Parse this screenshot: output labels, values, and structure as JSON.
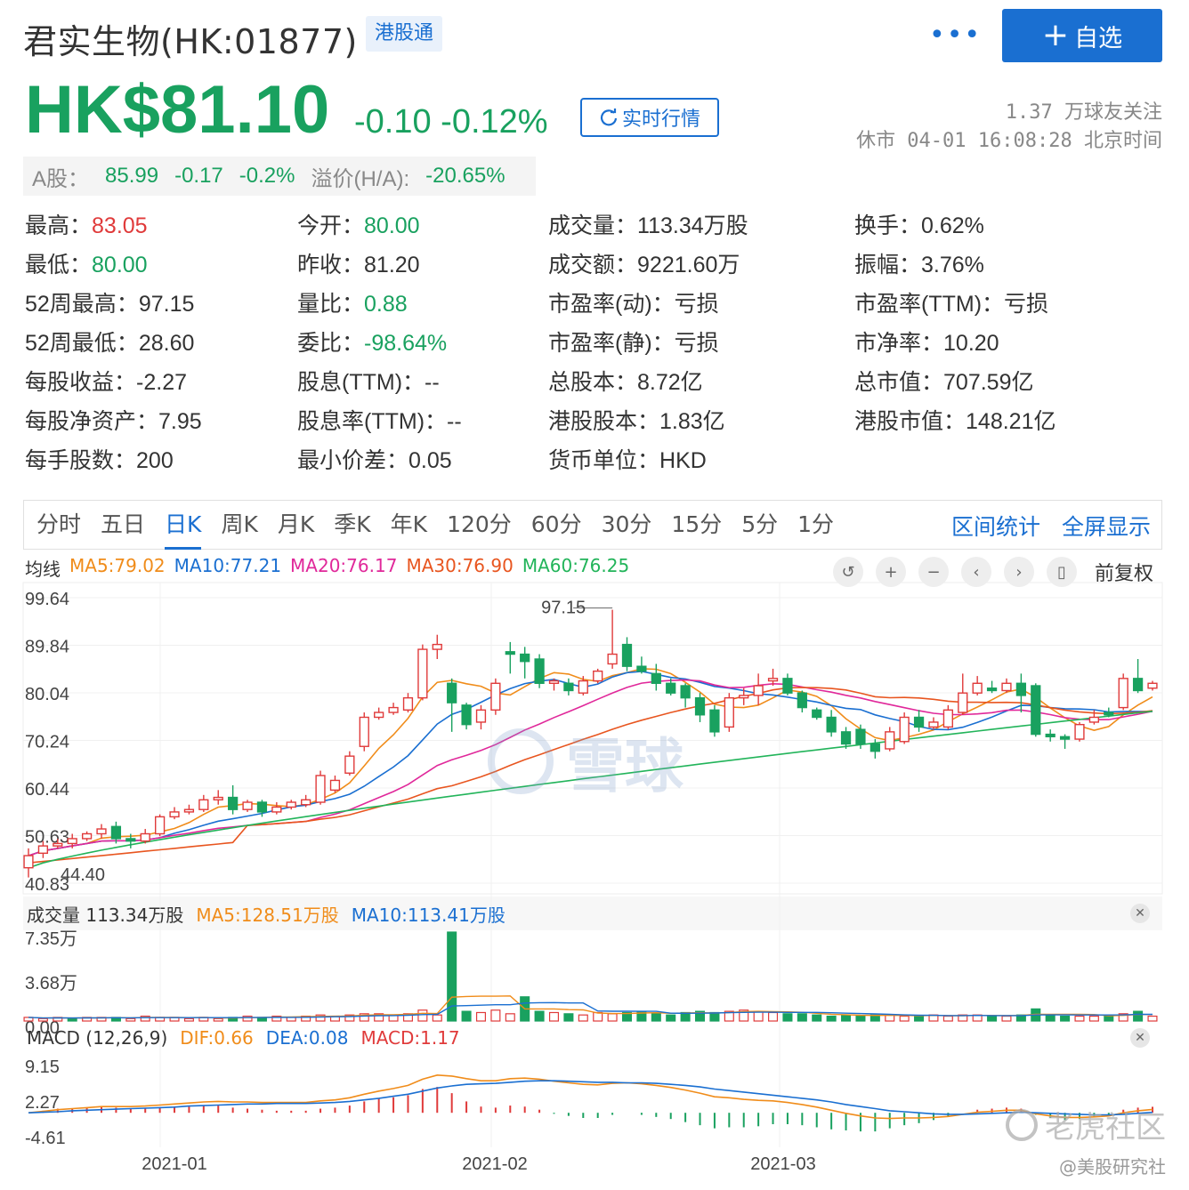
{
  "header": {
    "stock_name": "君实生物(HK:01877)",
    "connect_tag": "港股通",
    "more": "•••",
    "add_button": "自选",
    "price": "HK$81.10",
    "change": "-0.10 -0.12%",
    "realtime_button": "实时行情",
    "followers": "1.37 万球友关注",
    "status": "休市 04-01 16:08:28 北京时间"
  },
  "a_share": {
    "label": "A股：",
    "price": "85.99",
    "change": "-0.17",
    "pct": "-0.2%",
    "premium_label": "溢价(H/A):",
    "premium": "-20.65%"
  },
  "stats": [
    {
      "label": "最高：",
      "value": "83.05",
      "tone": "red"
    },
    {
      "label": "今开：",
      "value": "80.00",
      "tone": "green"
    },
    {
      "label": "成交量：",
      "value": "113.34万股",
      "tone": ""
    },
    {
      "label": "换手：",
      "value": "0.62%",
      "tone": ""
    },
    {
      "label": "最低：",
      "value": "80.00",
      "tone": "green"
    },
    {
      "label": "昨收：",
      "value": "81.20",
      "tone": ""
    },
    {
      "label": "成交额：",
      "value": "9221.60万",
      "tone": ""
    },
    {
      "label": "振幅：",
      "value": "3.76%",
      "tone": ""
    },
    {
      "label": "52周最高：",
      "value": "97.15",
      "tone": ""
    },
    {
      "label": "量比：",
      "value": "0.88",
      "tone": "green"
    },
    {
      "label": "市盈率(动)：",
      "value": "亏损",
      "tone": ""
    },
    {
      "label": "市盈率(TTM)：",
      "value": "亏损",
      "tone": ""
    },
    {
      "label": "52周最低：",
      "value": "28.60",
      "tone": ""
    },
    {
      "label": "委比：",
      "value": "-98.64%",
      "tone": "green"
    },
    {
      "label": "市盈率(静)：",
      "value": "亏损",
      "tone": ""
    },
    {
      "label": "市净率：",
      "value": "10.20",
      "tone": ""
    },
    {
      "label": "每股收益：",
      "value": "-2.27",
      "tone": ""
    },
    {
      "label": "股息(TTM)：",
      "value": "--",
      "tone": ""
    },
    {
      "label": "总股本：",
      "value": "8.72亿",
      "tone": ""
    },
    {
      "label": "总市值：",
      "value": "707.59亿",
      "tone": ""
    },
    {
      "label": "每股净资产：",
      "value": "7.95",
      "tone": ""
    },
    {
      "label": "股息率(TTM)：",
      "value": "--",
      "tone": ""
    },
    {
      "label": "港股股本：",
      "value": "1.83亿",
      "tone": ""
    },
    {
      "label": "港股市值：",
      "value": "148.21亿",
      "tone": ""
    },
    {
      "label": "每手股数：",
      "value": "200",
      "tone": ""
    },
    {
      "label": "最小价差：",
      "value": "0.05",
      "tone": ""
    },
    {
      "label": "货币单位：",
      "value": "HKD",
      "tone": ""
    }
  ],
  "tabs": [
    "分时",
    "五日",
    "日K",
    "周K",
    "月K",
    "季K",
    "年K",
    "120分",
    "60分",
    "30分",
    "15分",
    "5分",
    "1分"
  ],
  "active_tab": "日K",
  "tab_actions": [
    "区间统计",
    "全屏显示"
  ],
  "ma_legend": {
    "title": "均线",
    "items": [
      {
        "label": "MA5:79.02",
        "color": "#f08c1a"
      },
      {
        "label": "MA10:77.21",
        "color": "#1a6fd1"
      },
      {
        "label": "MA20:76.17",
        "color": "#e0289a"
      },
      {
        "label": "MA30:76.90",
        "color": "#e8551f"
      },
      {
        "label": "MA60:76.25",
        "color": "#22b45a"
      }
    ]
  },
  "adjust_label": "前复权",
  "volume_legend": {
    "title": "成交量 113.34万股",
    "ma5": "MA5:128.51万股",
    "ma10": "MA10:113.41万股"
  },
  "macd_legend": {
    "title": "MACD (12,26,9)",
    "dif": "DIF:0.66",
    "dea": "DEA:0.08",
    "macd": "MACD:1.17"
  },
  "watermark": "雪球",
  "corner_watermark": "老虎社区",
  "corner_sub": "@美股研究社",
  "colors": {
    "up": "#e03a3a",
    "down": "#19a15f",
    "accent": "#1a6fd1"
  },
  "chart_data": {
    "type": "candlestick",
    "price_axis": {
      "ticks": [
        "99.64",
        "89.84",
        "80.04",
        "70.24",
        "60.44",
        "50.63",
        "40.83"
      ],
      "ylim": [
        40.83,
        99.64
      ]
    },
    "x_labels": [
      "2021-01",
      "2021-02",
      "2021-03"
    ],
    "annotations": [
      {
        "label": "97.15",
        "type": "high"
      },
      {
        "label": "44.40",
        "type": "low"
      }
    ],
    "candles": [
      [
        44.0,
        46.5,
        42.0,
        48.0
      ],
      [
        47.0,
        48.5,
        46.0,
        49.5
      ],
      [
        48.5,
        49.0,
        48.0,
        50.0
      ],
      [
        49.0,
        50.0,
        48.0,
        51.0
      ],
      [
        50.0,
        51.0,
        49.5,
        51.5
      ],
      [
        51.0,
        52.0,
        50.0,
        53.0
      ],
      [
        52.5,
        50.0,
        49.0,
        53.5
      ],
      [
        50.0,
        49.5,
        48.0,
        51.0
      ],
      [
        49.5,
        51.0,
        49.0,
        52.0
      ],
      [
        51.0,
        54.5,
        50.5,
        55.0
      ],
      [
        54.5,
        55.5,
        54.0,
        56.5
      ],
      [
        55.5,
        56.0,
        55.0,
        57.0
      ],
      [
        56.0,
        58.0,
        55.5,
        59.0
      ],
      [
        58.0,
        58.5,
        57.0,
        60.0
      ],
      [
        58.5,
        56.0,
        55.0,
        61.0
      ],
      [
        56.0,
        57.5,
        55.5,
        58.0
      ],
      [
        57.5,
        55.5,
        54.5,
        58.0
      ],
      [
        55.5,
        56.5,
        55.0,
        57.5
      ],
      [
        56.5,
        57.5,
        56.0,
        58.0
      ],
      [
        57.0,
        58.0,
        56.5,
        59.0
      ],
      [
        57.5,
        63.0,
        57.0,
        64.0
      ],
      [
        60.0,
        62.0,
        59.5,
        63.0
      ],
      [
        63.5,
        67.0,
        63.0,
        68.0
      ],
      [
        69.0,
        75.0,
        68.0,
        76.0
      ],
      [
        75.0,
        76.0,
        74.5,
        77.0
      ],
      [
        76.0,
        77.0,
        75.5,
        78.0
      ],
      [
        76.5,
        79.0,
        76.0,
        80.0
      ],
      [
        79.0,
        89.0,
        78.5,
        90.0
      ],
      [
        89.0,
        90.0,
        87.0,
        92.0
      ],
      [
        82.0,
        78.0,
        72.0,
        83.0
      ],
      [
        77.5,
        73.5,
        72.5,
        78.0
      ],
      [
        74.0,
        76.5,
        72.5,
        77.5
      ],
      [
        76.5,
        82.0,
        75.5,
        83.0
      ],
      [
        88.5,
        88.0,
        84.0,
        90.5
      ],
      [
        88.0,
        86.5,
        83.0,
        89.5
      ],
      [
        87.0,
        82.0,
        81.0,
        88.0
      ],
      [
        82.0,
        82.5,
        80.5,
        83.0
      ],
      [
        82.0,
        80.5,
        79.5,
        83.0
      ],
      [
        80.0,
        82.5,
        79.5,
        83.5
      ],
      [
        82.5,
        84.5,
        82.0,
        85.0
      ],
      [
        86.0,
        88.0,
        85.0,
        97.15
      ],
      [
        90.0,
        85.5,
        84.5,
        91.5
      ],
      [
        85.5,
        84.5,
        84.0,
        87.5
      ],
      [
        84.0,
        82.0,
        80.5,
        86.0
      ],
      [
        82.0,
        80.0,
        79.5,
        83.0
      ],
      [
        81.5,
        79.0,
        77.0,
        82.0
      ],
      [
        79.0,
        75.5,
        74.0,
        80.0
      ],
      [
        76.5,
        72.0,
        71.0,
        77.5
      ],
      [
        73.0,
        79.0,
        72.0,
        80.0
      ],
      [
        79.0,
        79.5,
        77.5,
        81.0
      ],
      [
        79.5,
        81.5,
        77.5,
        84.0
      ],
      [
        82.5,
        83.0,
        81.5,
        85.0
      ],
      [
        83.0,
        80.0,
        79.5,
        84.0
      ],
      [
        80.0,
        77.0,
        76.0,
        80.5
      ],
      [
        76.5,
        75.0,
        74.5,
        77.0
      ],
      [
        75.0,
        72.0,
        71.0,
        76.5
      ],
      [
        72.0,
        69.5,
        68.5,
        73.0
      ],
      [
        72.5,
        69.5,
        68.5,
        73.5
      ],
      [
        69.5,
        68.0,
        66.5,
        70.5
      ],
      [
        68.5,
        72.0,
        68.0,
        73.0
      ],
      [
        70.0,
        75.0,
        69.5,
        76.0
      ],
      [
        75.0,
        73.0,
        72.0,
        76.5
      ],
      [
        73.0,
        74.0,
        72.5,
        75.0
      ],
      [
        73.0,
        76.5,
        72.5,
        77.5
      ],
      [
        76.0,
        80.0,
        75.5,
        84.0
      ],
      [
        80.0,
        82.0,
        79.5,
        83.5
      ],
      [
        81.0,
        80.5,
        80.0,
        82.5
      ],
      [
        80.5,
        82.0,
        80.0,
        83.0
      ],
      [
        82.0,
        79.5,
        76.0,
        84.0
      ],
      [
        81.5,
        71.5,
        71.0,
        82.0
      ],
      [
        71.5,
        71.0,
        70.0,
        72.5
      ],
      [
        71.0,
        70.5,
        68.5,
        71.5
      ],
      [
        70.5,
        73.5,
        70.0,
        74.0
      ],
      [
        74.0,
        75.0,
        73.5,
        76.5
      ],
      [
        76.0,
        75.5,
        75.0,
        77.0
      ],
      [
        77.0,
        83.0,
        76.5,
        84.0
      ],
      [
        83.0,
        80.5,
        80.0,
        87.0
      ],
      [
        81.0,
        82.0,
        80.5,
        82.5
      ]
    ],
    "volume_axis": {
      "ticks": [
        "7.35万",
        "3.68万",
        "0.00"
      ]
    },
    "volume": {
      "values": [
        0.3,
        0.2,
        0.3,
        0.2,
        0.3,
        0.3,
        0.3,
        0.2,
        0.4,
        0.3,
        0.3,
        0.2,
        0.3,
        0.2,
        0.3,
        0.4,
        0.3,
        0.4,
        0.3,
        0.4,
        0.5,
        0.4,
        0.5,
        0.6,
        0.6,
        0.5,
        0.6,
        0.9,
        0.5,
        7.35,
        0.8,
        0.7,
        0.9,
        0.6,
        2.0,
        0.8,
        0.7,
        0.6,
        0.5,
        0.7,
        0.6,
        0.7,
        0.8,
        0.6,
        0.5,
        0.7,
        0.8,
        0.7,
        0.8,
        0.9,
        0.8,
        0.7,
        0.6,
        0.6,
        0.5,
        0.4,
        0.5,
        0.4,
        0.5,
        0.5,
        0.4,
        0.4,
        0.5,
        0.4,
        0.5,
        0.5,
        0.4,
        0.4,
        0.5,
        1.0,
        0.5,
        0.4,
        0.4,
        0.4,
        0.5,
        0.6,
        0.8,
        0.4
      ],
      "up": [
        1,
        1,
        1,
        0,
        1,
        1,
        0,
        1,
        1,
        1,
        1,
        1,
        1,
        1,
        0,
        1,
        0,
        1,
        1,
        1,
        1,
        1,
        1,
        1,
        1,
        1,
        1,
        1,
        1,
        0,
        0,
        1,
        1,
        1,
        0,
        0,
        1,
        0,
        1,
        1,
        1,
        0,
        0,
        0,
        0,
        0,
        0,
        0,
        1,
        1,
        1,
        1,
        0,
        0,
        0,
        0,
        0,
        0,
        0,
        1,
        1,
        0,
        1,
        1,
        1,
        1,
        0,
        1,
        0,
        0,
        0,
        0,
        1,
        1,
        0,
        1,
        0,
        1
      ]
    },
    "macd_axis": {
      "ticks": [
        "9.15",
        "2.27",
        "-4.61"
      ]
    },
    "macd": {
      "dif": [
        0.0,
        0.3,
        0.6,
        0.8,
        1.0,
        1.2,
        1.2,
        1.2,
        1.3,
        1.5,
        1.7,
        1.9,
        2.1,
        2.2,
        2.1,
        2.1,
        2.0,
        2.0,
        2.0,
        2.0,
        2.3,
        2.5,
        2.9,
        3.6,
        4.2,
        4.7,
        5.3,
        6.5,
        7.3,
        7.1,
        6.6,
        6.2,
        6.2,
        6.6,
        6.7,
        6.5,
        6.1,
        5.8,
        5.5,
        5.4,
        5.7,
        5.8,
        5.6,
        5.3,
        4.9,
        4.4,
        3.8,
        3.1,
        2.9,
        2.6,
        2.4,
        2.3,
        2.0,
        1.6,
        1.1,
        0.5,
        -0.1,
        -0.6,
        -1.0,
        -1.1,
        -1.0,
        -1.0,
        -0.9,
        -0.7,
        -0.3,
        0.1,
        0.3,
        0.5,
        0.5,
        -0.2,
        -0.6,
        -0.9,
        -0.9,
        -0.8,
        -0.6,
        0.0,
        0.4,
        0.66
      ],
      "dea": [
        0.0,
        0.1,
        0.2,
        0.4,
        0.5,
        0.6,
        0.7,
        0.8,
        0.9,
        1.0,
        1.1,
        1.3,
        1.4,
        1.5,
        1.6,
        1.7,
        1.7,
        1.8,
        1.8,
        1.8,
        1.9,
        2.0,
        2.2,
        2.5,
        2.8,
        3.2,
        3.6,
        4.2,
        4.8,
        5.2,
        5.5,
        5.6,
        5.7,
        5.9,
        6.1,
        6.2,
        6.2,
        6.1,
        6.0,
        5.9,
        5.9,
        5.8,
        5.8,
        5.7,
        5.5,
        5.3,
        5.0,
        4.6,
        4.3,
        4.0,
        3.7,
        3.4,
        3.1,
        2.8,
        2.5,
        2.1,
        1.6,
        1.2,
        0.8,
        0.4,
        0.2,
        0.0,
        -0.2,
        -0.3,
        -0.3,
        -0.2,
        -0.1,
        0.0,
        0.1,
        0.0,
        -0.1,
        -0.2,
        -0.3,
        -0.4,
        -0.4,
        -0.3,
        -0.1,
        0.08
      ]
    }
  }
}
